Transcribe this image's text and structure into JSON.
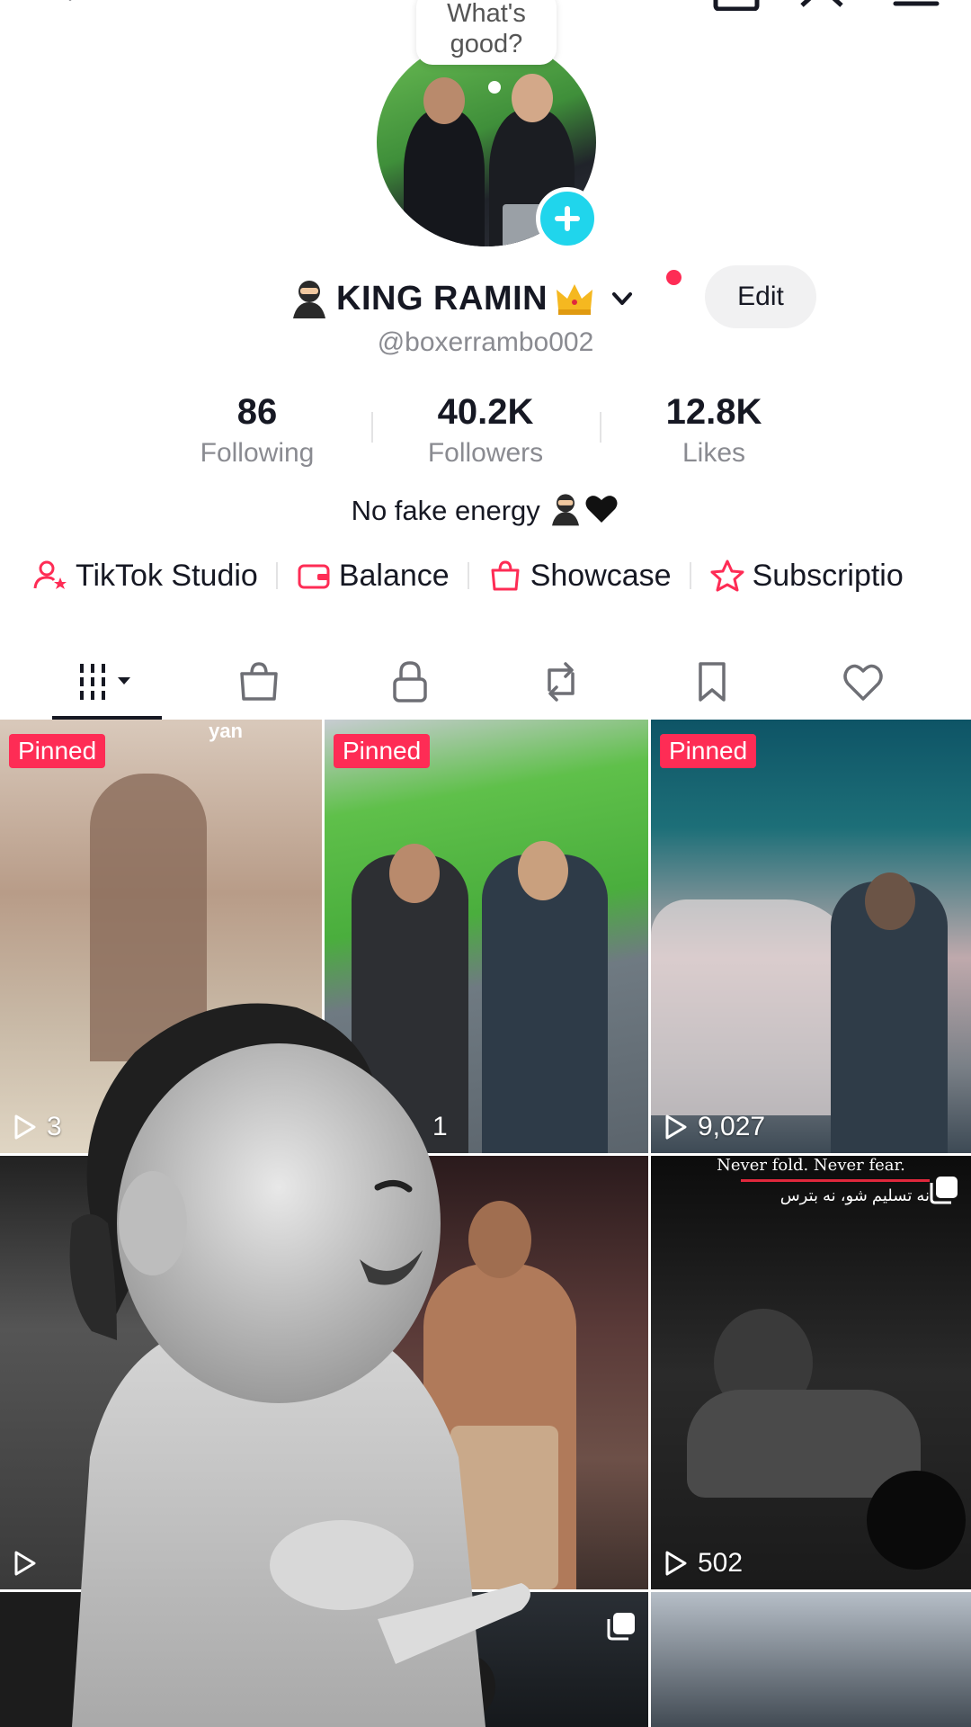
{
  "bubble": {
    "text": "What's good?"
  },
  "profile": {
    "display_name": "KING RAMIN",
    "username": "@boxerrambo002",
    "edit_label": "Edit",
    "bio": "No fake energy"
  },
  "stats": {
    "following": {
      "value": "86",
      "label": "Following"
    },
    "followers": {
      "value": "40.2K",
      "label": "Followers"
    },
    "likes": {
      "value": "12.8K",
      "label": "Likes"
    }
  },
  "links": [
    {
      "label": "TikTok Studio",
      "icon": "user-star-icon"
    },
    {
      "label": "Balance",
      "icon": "wallet-icon"
    },
    {
      "label": "Showcase",
      "icon": "shopping-bag-icon"
    },
    {
      "label": "Subscriptio",
      "icon": "star-badge-icon"
    }
  ],
  "tabs": [
    {
      "icon": "videos-grid-icon",
      "selected": true
    },
    {
      "icon": "shop-icon"
    },
    {
      "icon": "lock-icon"
    },
    {
      "icon": "repost-icon"
    },
    {
      "icon": "bookmark-icon"
    },
    {
      "icon": "heart-icon"
    }
  ],
  "grid": {
    "pinned_label": "Pinned",
    "tiles": [
      {
        "pinned": true,
        "views": "3",
        "caption": "yan"
      },
      {
        "pinned": true,
        "views": "1"
      },
      {
        "pinned": true,
        "views": "9,027"
      },
      {
        "views": ""
      },
      {
        "views": ""
      },
      {
        "views": "502",
        "caption_en": "Never fold. Never fear.",
        "caption_fa": "نه تسلیم شو، نه بترس",
        "multi": true
      },
      {
        "views": ""
      },
      {
        "multi": true
      },
      {
        "views": ""
      }
    ]
  },
  "colors": {
    "accent": "#fe2c55",
    "cyan": "#20d5ec",
    "text": "#161823",
    "muted": "#8a8b91"
  }
}
